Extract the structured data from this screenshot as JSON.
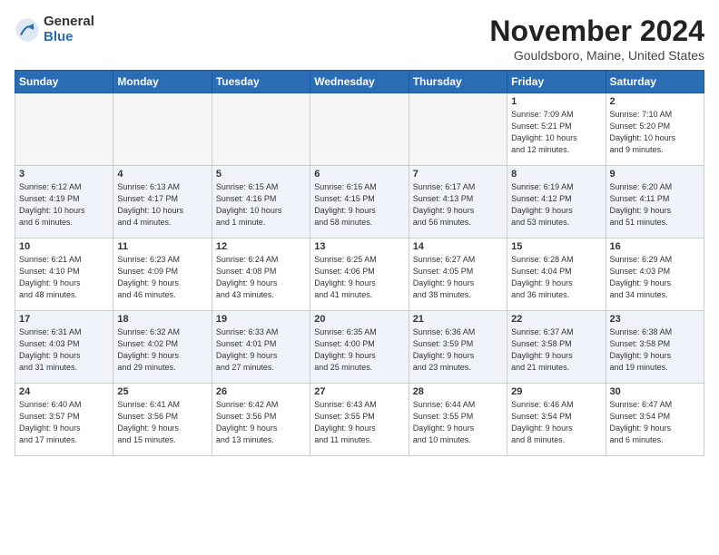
{
  "logo": {
    "general": "General",
    "blue": "Blue"
  },
  "title": "November 2024",
  "location": "Gouldsboro, Maine, United States",
  "days_of_week": [
    "Sunday",
    "Monday",
    "Tuesday",
    "Wednesday",
    "Thursday",
    "Friday",
    "Saturday"
  ],
  "weeks": [
    [
      {
        "day": "",
        "info": "",
        "empty": true
      },
      {
        "day": "",
        "info": "",
        "empty": true
      },
      {
        "day": "",
        "info": "",
        "empty": true
      },
      {
        "day": "",
        "info": "",
        "empty": true
      },
      {
        "day": "",
        "info": "",
        "empty": true
      },
      {
        "day": "1",
        "info": "Sunrise: 7:09 AM\nSunset: 5:21 PM\nDaylight: 10 hours\nand 12 minutes."
      },
      {
        "day": "2",
        "info": "Sunrise: 7:10 AM\nSunset: 5:20 PM\nDaylight: 10 hours\nand 9 minutes."
      }
    ],
    [
      {
        "day": "3",
        "info": "Sunrise: 6:12 AM\nSunset: 4:19 PM\nDaylight: 10 hours\nand 6 minutes."
      },
      {
        "day": "4",
        "info": "Sunrise: 6:13 AM\nSunset: 4:17 PM\nDaylight: 10 hours\nand 4 minutes."
      },
      {
        "day": "5",
        "info": "Sunrise: 6:15 AM\nSunset: 4:16 PM\nDaylight: 10 hours\nand 1 minute."
      },
      {
        "day": "6",
        "info": "Sunrise: 6:16 AM\nSunset: 4:15 PM\nDaylight: 9 hours\nand 58 minutes."
      },
      {
        "day": "7",
        "info": "Sunrise: 6:17 AM\nSunset: 4:13 PM\nDaylight: 9 hours\nand 56 minutes."
      },
      {
        "day": "8",
        "info": "Sunrise: 6:19 AM\nSunset: 4:12 PM\nDaylight: 9 hours\nand 53 minutes."
      },
      {
        "day": "9",
        "info": "Sunrise: 6:20 AM\nSunset: 4:11 PM\nDaylight: 9 hours\nand 51 minutes."
      }
    ],
    [
      {
        "day": "10",
        "info": "Sunrise: 6:21 AM\nSunset: 4:10 PM\nDaylight: 9 hours\nand 48 minutes."
      },
      {
        "day": "11",
        "info": "Sunrise: 6:23 AM\nSunset: 4:09 PM\nDaylight: 9 hours\nand 46 minutes."
      },
      {
        "day": "12",
        "info": "Sunrise: 6:24 AM\nSunset: 4:08 PM\nDaylight: 9 hours\nand 43 minutes."
      },
      {
        "day": "13",
        "info": "Sunrise: 6:25 AM\nSunset: 4:06 PM\nDaylight: 9 hours\nand 41 minutes."
      },
      {
        "day": "14",
        "info": "Sunrise: 6:27 AM\nSunset: 4:05 PM\nDaylight: 9 hours\nand 38 minutes."
      },
      {
        "day": "15",
        "info": "Sunrise: 6:28 AM\nSunset: 4:04 PM\nDaylight: 9 hours\nand 36 minutes."
      },
      {
        "day": "16",
        "info": "Sunrise: 6:29 AM\nSunset: 4:03 PM\nDaylight: 9 hours\nand 34 minutes."
      }
    ],
    [
      {
        "day": "17",
        "info": "Sunrise: 6:31 AM\nSunset: 4:03 PM\nDaylight: 9 hours\nand 31 minutes."
      },
      {
        "day": "18",
        "info": "Sunrise: 6:32 AM\nSunset: 4:02 PM\nDaylight: 9 hours\nand 29 minutes."
      },
      {
        "day": "19",
        "info": "Sunrise: 6:33 AM\nSunset: 4:01 PM\nDaylight: 9 hours\nand 27 minutes."
      },
      {
        "day": "20",
        "info": "Sunrise: 6:35 AM\nSunset: 4:00 PM\nDaylight: 9 hours\nand 25 minutes."
      },
      {
        "day": "21",
        "info": "Sunrise: 6:36 AM\nSunset: 3:59 PM\nDaylight: 9 hours\nand 23 minutes."
      },
      {
        "day": "22",
        "info": "Sunrise: 6:37 AM\nSunset: 3:58 PM\nDaylight: 9 hours\nand 21 minutes."
      },
      {
        "day": "23",
        "info": "Sunrise: 6:38 AM\nSunset: 3:58 PM\nDaylight: 9 hours\nand 19 minutes."
      }
    ],
    [
      {
        "day": "24",
        "info": "Sunrise: 6:40 AM\nSunset: 3:57 PM\nDaylight: 9 hours\nand 17 minutes."
      },
      {
        "day": "25",
        "info": "Sunrise: 6:41 AM\nSunset: 3:56 PM\nDaylight: 9 hours\nand 15 minutes."
      },
      {
        "day": "26",
        "info": "Sunrise: 6:42 AM\nSunset: 3:56 PM\nDaylight: 9 hours\nand 13 minutes."
      },
      {
        "day": "27",
        "info": "Sunrise: 6:43 AM\nSunset: 3:55 PM\nDaylight: 9 hours\nand 11 minutes."
      },
      {
        "day": "28",
        "info": "Sunrise: 6:44 AM\nSunset: 3:55 PM\nDaylight: 9 hours\nand 10 minutes."
      },
      {
        "day": "29",
        "info": "Sunrise: 6:46 AM\nSunset: 3:54 PM\nDaylight: 9 hours\nand 8 minutes."
      },
      {
        "day": "30",
        "info": "Sunrise: 6:47 AM\nSunset: 3:54 PM\nDaylight: 9 hours\nand 6 minutes."
      }
    ]
  ]
}
